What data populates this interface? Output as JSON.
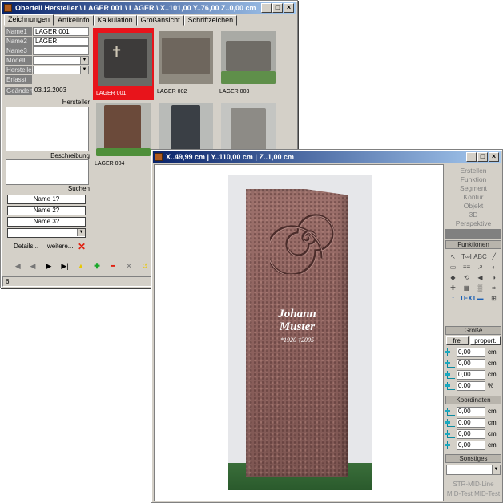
{
  "win1": {
    "title": "Oberteil Hersteller \\ LAGER 001 \\ LAGER \\ X..101,00  Y..76,00  Z..0,00 cm",
    "tabs": [
      "Zeichnungen",
      "Artikelinfo",
      "Kalkulation",
      "Großansicht",
      "Schriftzeichen"
    ],
    "fields": [
      {
        "label": "Name1",
        "value": "LAGER 001"
      },
      {
        "label": "Name2",
        "value": "LAGER"
      },
      {
        "label": "Name3",
        "value": ""
      },
      {
        "label": "Modell",
        "value": ""
      },
      {
        "label": "Hersteller",
        "value": ""
      },
      {
        "label": "Erfasst",
        "value": ""
      },
      {
        "label": "Geändert",
        "value": "03.12.2003"
      }
    ],
    "sections": {
      "hersteller": "Hersteller",
      "beschreibung": "Beschreibung",
      "suchen": "Suchen"
    },
    "search_names": [
      "Name 1?",
      "Name 2?",
      "Name 3?"
    ],
    "details_label": "Details...",
    "weitere_label": "weitere...",
    "thumbnails": [
      "LAGER 001",
      "LAGER 002",
      "LAGER 003",
      "LAGER 004"
    ],
    "status": "6"
  },
  "win2": {
    "title": "X..49,99 cm | Y..110,00 cm | Z..1,00 cm",
    "inscription": {
      "name1": "Johann",
      "name2": "Muster",
      "dates": "*1920  †2005"
    },
    "menu": [
      "Erstellen",
      "Funktion",
      "Segment",
      "Kontur",
      "Objekt",
      "3D",
      "Perspektive"
    ],
    "funktionen_header": "Funktionen",
    "tools": [
      "↖",
      "T∞I",
      "ABC",
      "╱",
      "▭",
      "≡≡",
      "↗",
      "◐",
      "◆",
      "⟲",
      "◀",
      "◑",
      "✚",
      "▦",
      "▒",
      "⌗",
      "↕",
      "TEXT",
      "▬",
      "⊞"
    ],
    "groesse_header": "Größe",
    "groesse_tabs": [
      "frei",
      "proport."
    ],
    "groesse": [
      {
        "value": "0,00",
        "unit": "cm"
      },
      {
        "value": "0,00",
        "unit": "cm"
      },
      {
        "value": "0,00",
        "unit": "cm"
      },
      {
        "value": "0,00",
        "unit": "%"
      }
    ],
    "koordinaten_header": "Koordinaten",
    "koordinaten": [
      {
        "value": "0,00",
        "unit": "cm"
      },
      {
        "value": "0,00",
        "unit": "cm"
      },
      {
        "value": "0,00",
        "unit": "cm"
      },
      {
        "value": "0,00",
        "unit": "cm"
      }
    ],
    "sonstiges_header": "Sonstiges",
    "footer": [
      "STR-MID-Line",
      "MID-Test  MID-Test"
    ]
  },
  "colors": {
    "title_active": "#0a246a",
    "selection": "#e8141b",
    "panel": "#d4d0c8"
  }
}
